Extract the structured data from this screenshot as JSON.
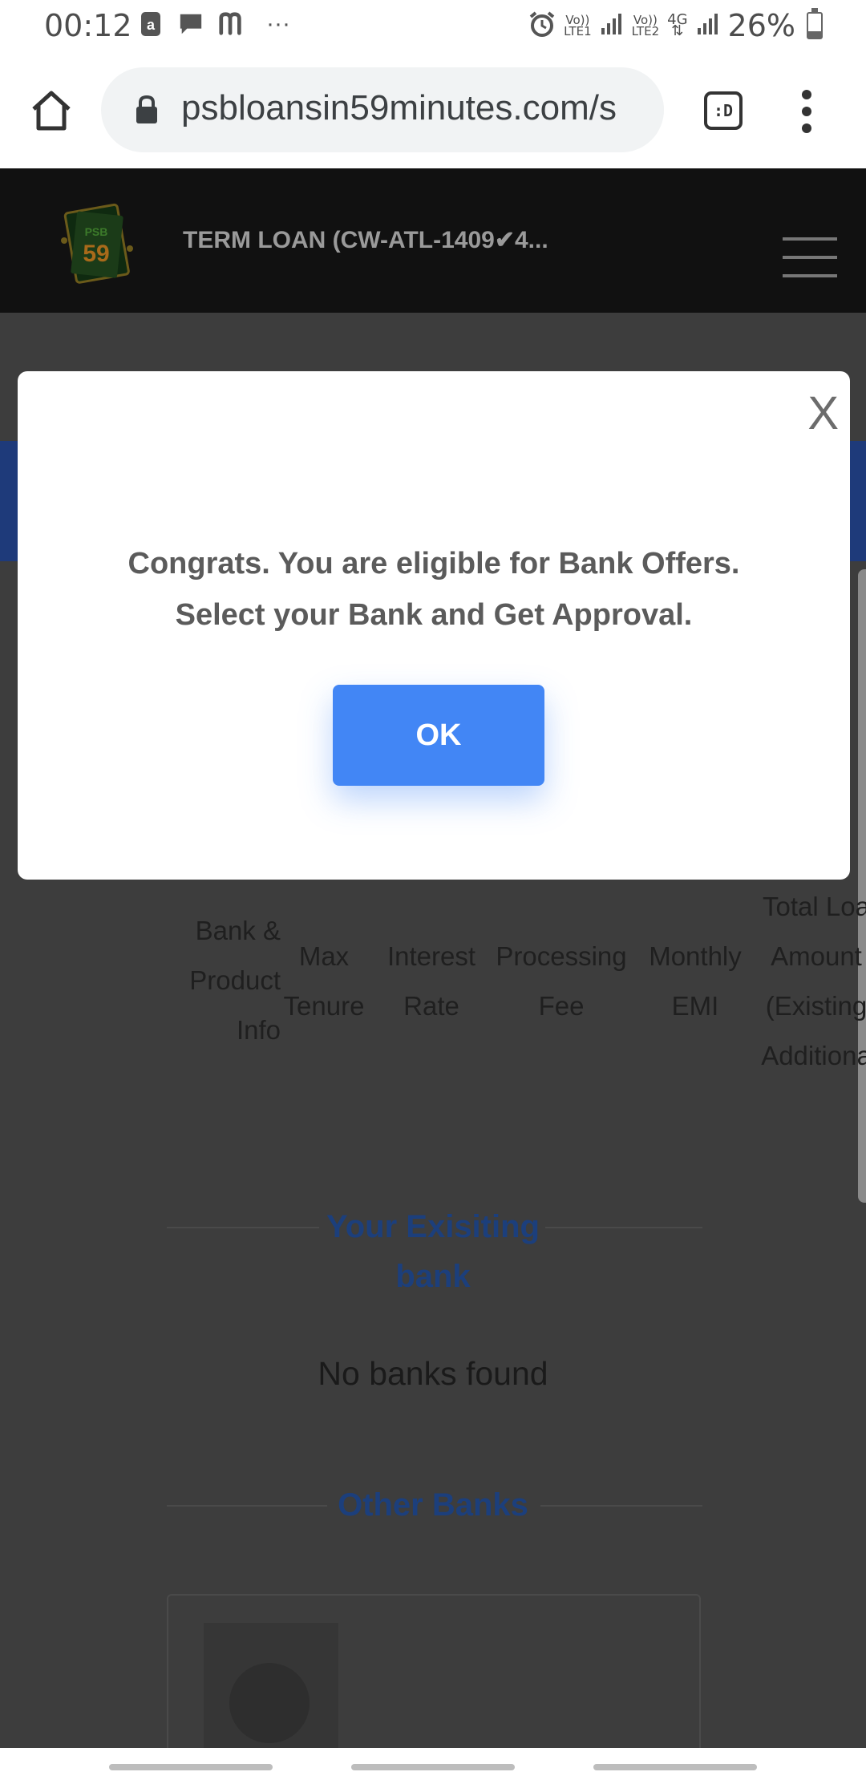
{
  "status_bar": {
    "time": "00:12",
    "network1": {
      "top": "Vo))",
      "bottom": "LTE1"
    },
    "network2": {
      "top": "Vo))",
      "bottom": "LTE2"
    },
    "network_type": "4G",
    "battery": "26%",
    "battery_level": 0.26,
    "more": "···",
    "icons": [
      "amazon-icon",
      "message-icon",
      "myntra-icon",
      "alarm-icon",
      "signal-icon",
      "data-arrows-icon",
      "battery-icon"
    ]
  },
  "browser": {
    "url": "psbloansin59minutes.com/s",
    "tab_label": ":D",
    "icons": [
      "home-icon",
      "lock-icon",
      "tab-switcher-icon",
      "more-vert-icon"
    ]
  },
  "header": {
    "logo_text_top": "PSB",
    "logo_number": "59",
    "title": "TERM LOAN (CW-ATL-1409✔4...",
    "menu_icon": "hamburger-icon"
  },
  "table": {
    "columns": [
      {
        "lines": [
          "Bank &",
          "Product",
          "Info"
        ]
      },
      {
        "lines": [
          "Max",
          "Tenure"
        ]
      },
      {
        "lines": [
          "Interest",
          "Rate"
        ]
      },
      {
        "lines": [
          "Processing",
          "Fee"
        ]
      },
      {
        "lines": [
          "Monthly",
          "EMI"
        ]
      },
      {
        "lines": [
          "Total Loa",
          "Amount",
          "(Existing",
          "Additiona"
        ]
      }
    ]
  },
  "sections": {
    "existing_bank_line1": "Your Exisiting",
    "existing_bank_line2": "bank",
    "no_banks": "No banks found",
    "other_banks": "Other Banks"
  },
  "modal": {
    "close_label": "X",
    "message_line1": "Congrats. You are eligible for Bank Offers.",
    "message_line2": "Select your Bank and Get Approval.",
    "ok_label": "OK"
  },
  "colors": {
    "ok_button": "#4286f5",
    "section_title": "#1c3f7c",
    "header_bg": "#111111"
  }
}
